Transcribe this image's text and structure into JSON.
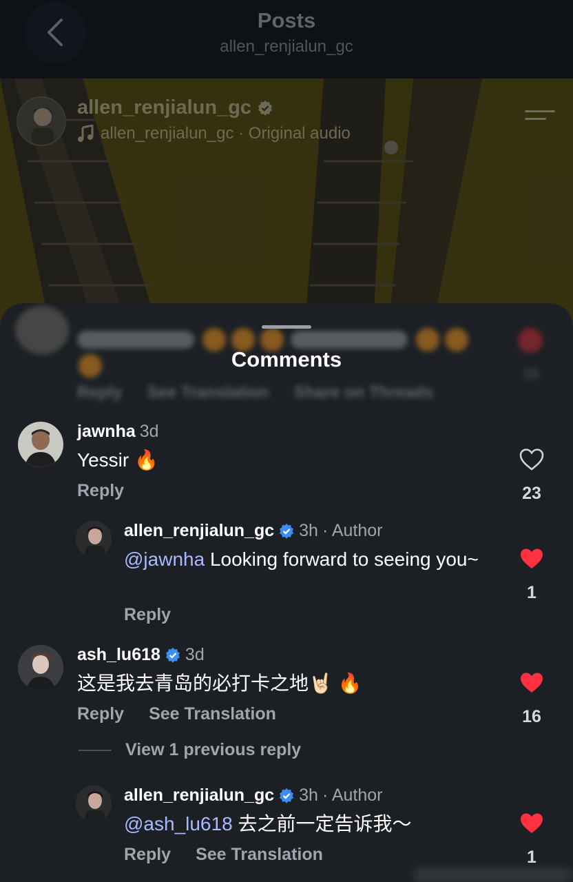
{
  "header": {
    "title": "Posts",
    "subtitle": "allen_renjialun_gc"
  },
  "post": {
    "username": "allen_renjialun_gc",
    "audio": "allen_renjialun_gc · Original audio"
  },
  "sheet": {
    "title": "Comments",
    "blurred_actions": [
      "Reply",
      "See Translation",
      "Share on Threads"
    ],
    "blurred_count": "15"
  },
  "comments": [
    {
      "username": "jawnha",
      "time": "3d",
      "text": "Yessir 🔥",
      "reply_label": "Reply",
      "likes": "23",
      "liked": false
    },
    {
      "username": "allen_renjialun_gc",
      "time": "3h",
      "author_tag": "· Author",
      "mention": "@jawnha",
      "text": "Looking forward to seeing you~",
      "reply_label": "Reply",
      "likes": "1",
      "liked": true
    },
    {
      "username": "ash_lu618",
      "time": "3d",
      "text": "这是我去青岛的必打卡之地🤘🏻 🔥",
      "reply_label": "Reply",
      "translate_label": "See Translation",
      "likes": "16",
      "liked": true
    },
    {
      "username": "allen_renjialun_gc",
      "time": "3h",
      "author_tag": "· Author",
      "mention": "@ash_lu618",
      "text": "去之前一定告诉我～",
      "reply_label": "Reply",
      "translate_label": "See Translation",
      "likes": "1",
      "liked": true
    }
  ],
  "view_replies": "View 1 previous reply",
  "colors": {
    "sheet_bg": "#1c2025",
    "heart_red": "#ff3040",
    "verified_blue": "#3a8ff5",
    "mention_blue": "#a8b9ff"
  }
}
